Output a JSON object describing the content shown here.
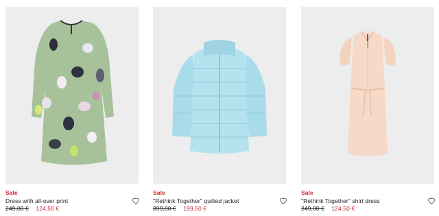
{
  "products": [
    {
      "badge": "Sale",
      "name": "Dress with all-over print",
      "old_price": "249,00 €",
      "new_price": "124,50 €",
      "image_icon": "floral-dress-image"
    },
    {
      "badge": "Sale",
      "name": "\"Rethink Together\" quilted jacket",
      "old_price": "399,00 €",
      "new_price": "199,50 €",
      "image_icon": "quilted-jacket-image"
    },
    {
      "badge": "Sale",
      "name": "\"Rethink Together\" shirt dress",
      "old_price": "249,00 €",
      "new_price": "124,50 €",
      "image_icon": "shirt-dress-image"
    }
  ],
  "colors": {
    "sale": "#d0202f",
    "image_bg": "#ededed",
    "dress_green": "#a7c29a",
    "jacket_blue": "#a9dcea",
    "shirt_dress_pink": "#f6d9c7"
  }
}
